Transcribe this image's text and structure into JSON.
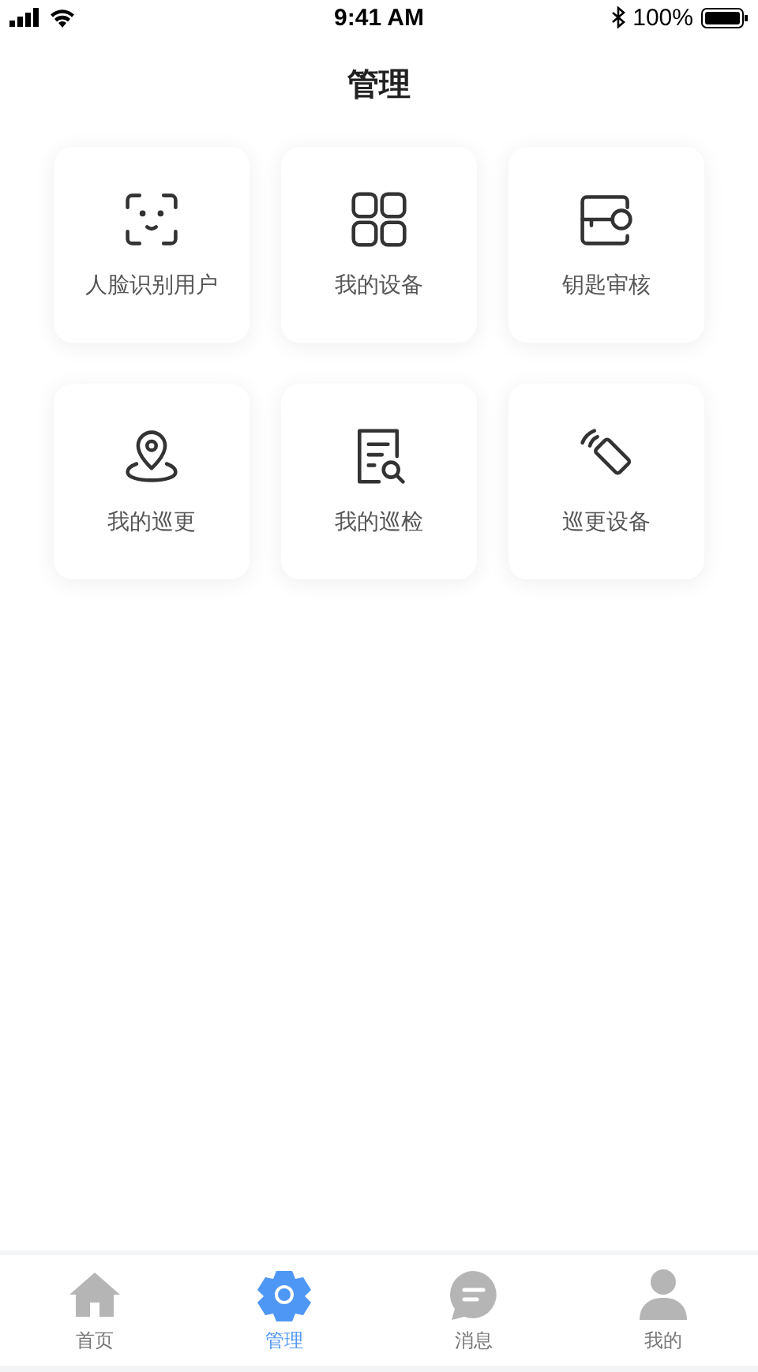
{
  "status_bar": {
    "time": "9:41 AM",
    "battery": "100%"
  },
  "title": "管理",
  "tiles": [
    {
      "label": "人脸识别用户",
      "kind": "face"
    },
    {
      "label": "我的设备",
      "kind": "grid"
    },
    {
      "label": "钥匙审核",
      "kind": "key"
    },
    {
      "label": "我的巡更",
      "kind": "location"
    },
    {
      "label": "我的巡检",
      "kind": "inspect"
    },
    {
      "label": "巡更设备",
      "kind": "device"
    }
  ],
  "tab_bar": [
    {
      "label": "首页",
      "kind": "home",
      "selected": false
    },
    {
      "label": "管理",
      "kind": "gear",
      "selected": true
    },
    {
      "label": "消息",
      "kind": "chat",
      "selected": false
    },
    {
      "label": "我的",
      "kind": "person",
      "selected": false
    }
  ]
}
